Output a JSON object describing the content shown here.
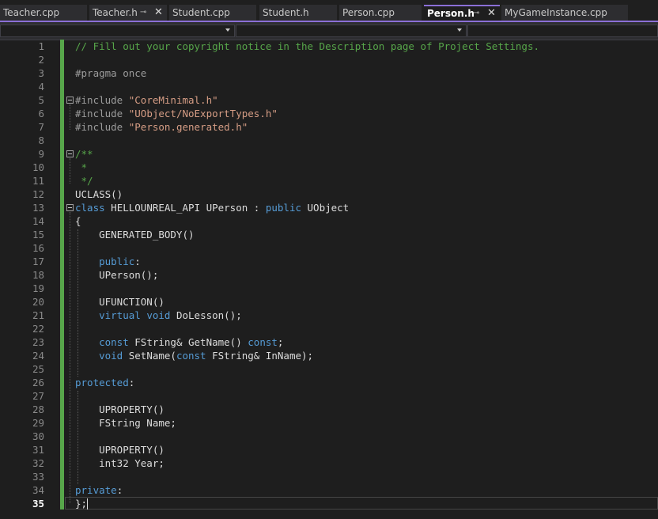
{
  "tabs": [
    {
      "label": "Teacher.cpp",
      "active": false
    },
    {
      "label": "Teacher.h",
      "active": false,
      "pinned": true,
      "closable": true
    },
    {
      "label": "Student.cpp",
      "active": false
    },
    {
      "label": "Student.h",
      "active": false
    },
    {
      "label": "Person.cpp",
      "active": false
    },
    {
      "label": "Person.h",
      "active": true,
      "pinned": true,
      "closable": true
    },
    {
      "label": "MyGameInstance.cpp",
      "active": false
    }
  ],
  "icons": {
    "pin": "pin-icon",
    "close": "close-icon",
    "dropdown": "chevron-down-icon",
    "fold": "collapse-minus-icon"
  },
  "colors": {
    "accent": "#8b6fd6",
    "comment": "#57a64a",
    "keyword": "#569cd6",
    "string": "#d69d85",
    "change_bar": "#57a64a"
  },
  "editor": {
    "current_line": 35,
    "lines": [
      {
        "n": "1",
        "code": "// Fill out your copyright notice in the Description page of Project Settings."
      },
      {
        "n": "2",
        "code": ""
      },
      {
        "n": "3",
        "code": "#pragma once"
      },
      {
        "n": "4",
        "code": ""
      },
      {
        "n": "5",
        "code": "#include \"CoreMinimal.h\""
      },
      {
        "n": "6",
        "code": "#include \"UObject/NoExportTypes.h\""
      },
      {
        "n": "7",
        "code": "#include \"Person.generated.h\""
      },
      {
        "n": "8",
        "code": ""
      },
      {
        "n": "9",
        "code": "/**"
      },
      {
        "n": "10",
        "code": " *"
      },
      {
        "n": "11",
        "code": " */"
      },
      {
        "n": "12",
        "code": "UCLASS()"
      },
      {
        "n": "13",
        "code": "class HELLOUNREAL_API UPerson : public UObject"
      },
      {
        "n": "14",
        "code": "{"
      },
      {
        "n": "15",
        "code": "    GENERATED_BODY()"
      },
      {
        "n": "16",
        "code": ""
      },
      {
        "n": "17",
        "code": "    public:"
      },
      {
        "n": "18",
        "code": "    UPerson();"
      },
      {
        "n": "19",
        "code": ""
      },
      {
        "n": "20",
        "code": "    UFUNCTION()"
      },
      {
        "n": "21",
        "code": "    virtual void DoLesson();"
      },
      {
        "n": "22",
        "code": ""
      },
      {
        "n": "23",
        "code": "    const FString& GetName() const;"
      },
      {
        "n": "24",
        "code": "    void SetName(const FString& InName);"
      },
      {
        "n": "25",
        "code": ""
      },
      {
        "n": "26",
        "code": "protected:"
      },
      {
        "n": "27",
        "code": ""
      },
      {
        "n": "28",
        "code": "    UPROPERTY()"
      },
      {
        "n": "29",
        "code": "    FString Name;"
      },
      {
        "n": "30",
        "code": ""
      },
      {
        "n": "31",
        "code": "    UPROPERTY()"
      },
      {
        "n": "32",
        "code": "    int32 Year;"
      },
      {
        "n": "33",
        "code": ""
      },
      {
        "n": "34",
        "code": "private:"
      },
      {
        "n": "35",
        "code": "};"
      }
    ]
  }
}
